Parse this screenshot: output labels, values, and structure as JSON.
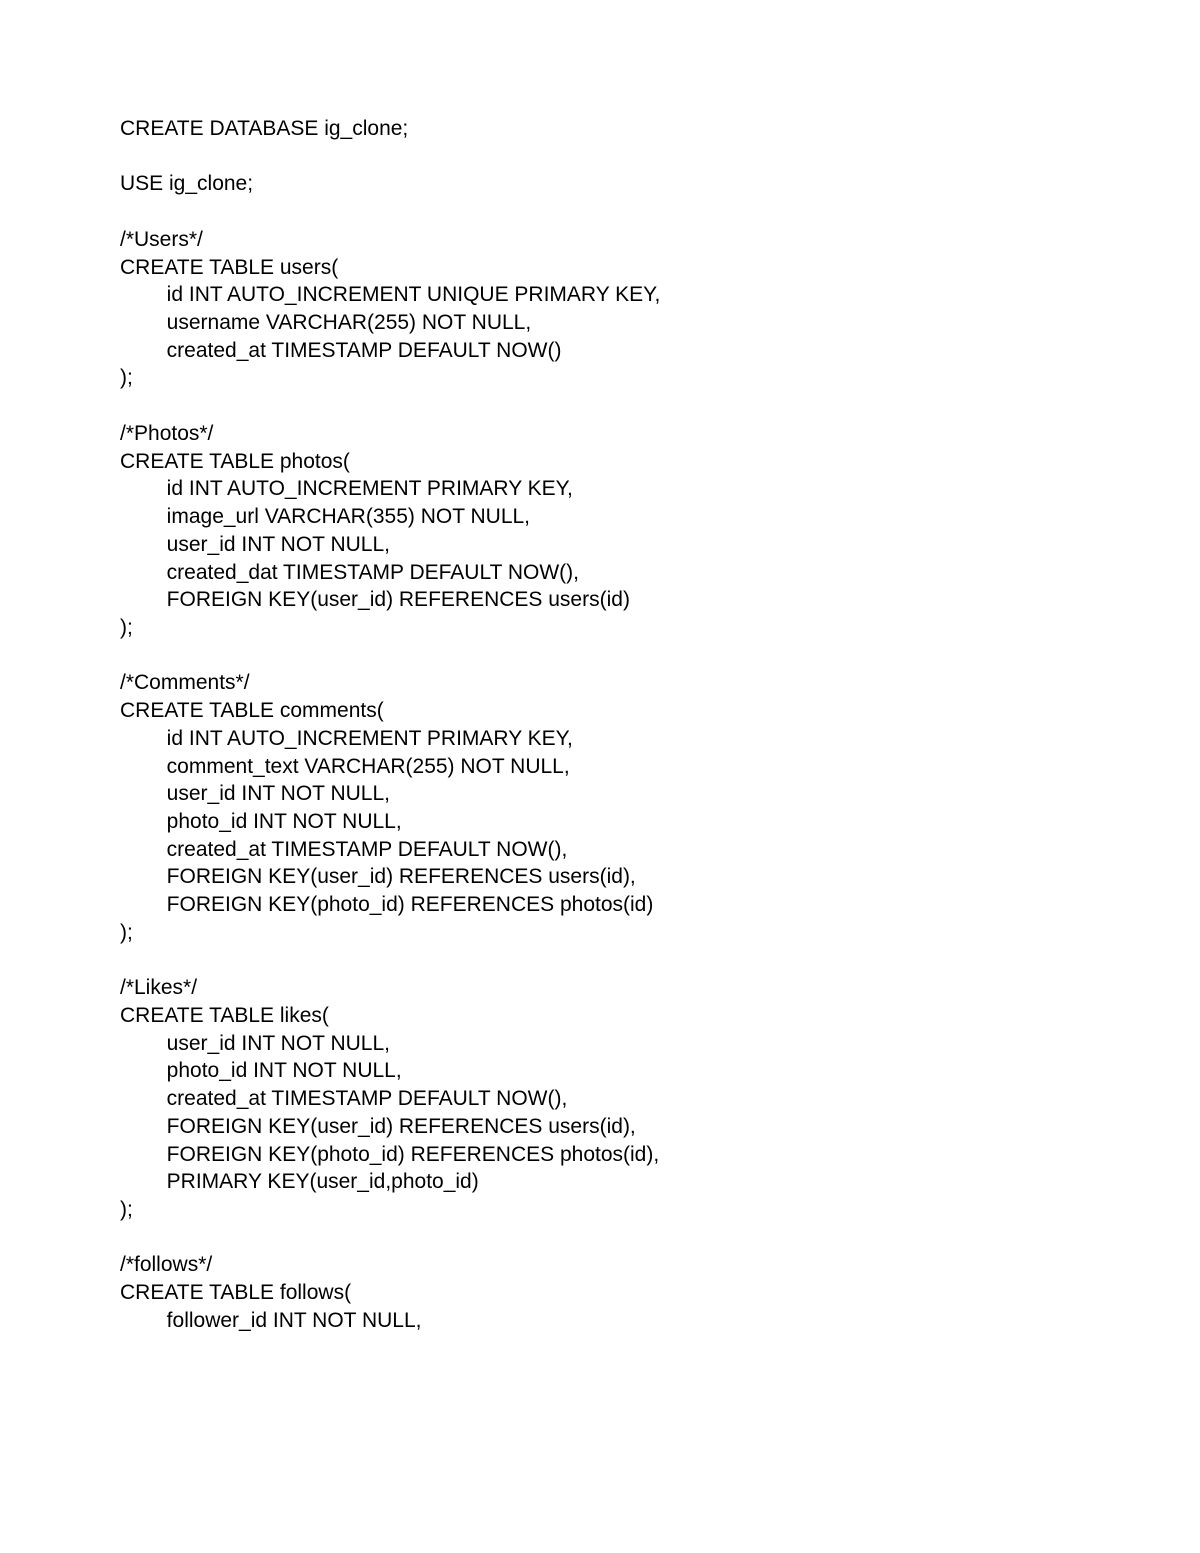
{
  "code": {
    "lines": [
      "CREATE DATABASE ig_clone;",
      "",
      "USE ig_clone;",
      "",
      "/*Users*/",
      "CREATE TABLE users(",
      "        id INT AUTO_INCREMENT UNIQUE PRIMARY KEY,",
      "        username VARCHAR(255) NOT NULL,",
      "        created_at TIMESTAMP DEFAULT NOW()",
      ");",
      "",
      "/*Photos*/",
      "CREATE TABLE photos(",
      "        id INT AUTO_INCREMENT PRIMARY KEY,",
      "        image_url VARCHAR(355) NOT NULL,",
      "        user_id INT NOT NULL,",
      "        created_dat TIMESTAMP DEFAULT NOW(),",
      "        FOREIGN KEY(user_id) REFERENCES users(id)",
      ");",
      "",
      "/*Comments*/",
      "CREATE TABLE comments(",
      "        id INT AUTO_INCREMENT PRIMARY KEY,",
      "        comment_text VARCHAR(255) NOT NULL,",
      "        user_id INT NOT NULL,",
      "        photo_id INT NOT NULL,",
      "        created_at TIMESTAMP DEFAULT NOW(),",
      "        FOREIGN KEY(user_id) REFERENCES users(id),",
      "        FOREIGN KEY(photo_id) REFERENCES photos(id)",
      ");",
      "",
      "/*Likes*/",
      "CREATE TABLE likes(",
      "        user_id INT NOT NULL,",
      "        photo_id INT NOT NULL,",
      "        created_at TIMESTAMP DEFAULT NOW(),",
      "        FOREIGN KEY(user_id) REFERENCES users(id),",
      "        FOREIGN KEY(photo_id) REFERENCES photos(id),",
      "        PRIMARY KEY(user_id,photo_id)",
      ");",
      "",
      "/*follows*/",
      "CREATE TABLE follows(",
      "        follower_id INT NOT NULL,"
    ]
  }
}
